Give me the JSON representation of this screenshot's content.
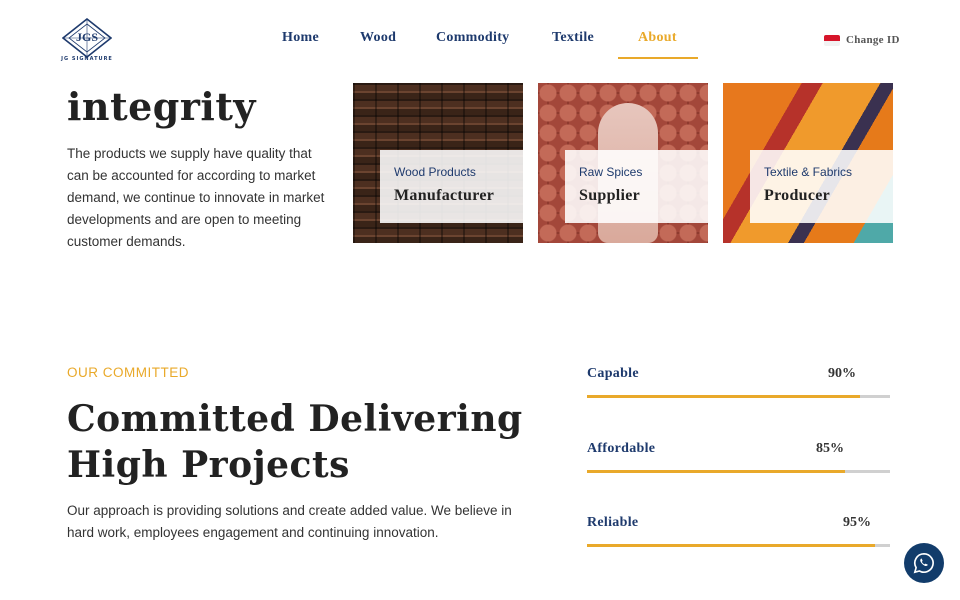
{
  "header": {
    "logo_mark": "JGS",
    "logo_text": "JG SIGNATURE",
    "nav": [
      {
        "label": "Home"
      },
      {
        "label": "Wood"
      },
      {
        "label": "Commodity"
      },
      {
        "label": "Textile"
      },
      {
        "label": "About"
      }
    ],
    "active_nav": "About",
    "language_label": "Change ID",
    "language_flag": "indonesia-flag-icon"
  },
  "hero": {
    "heading": "integrity",
    "paragraph": "The products we supply have quality that can be accounted for according to market demand, we continue to innovate in market developments and are open to meeting customer demands.",
    "cards": [
      {
        "subtitle": "Wood Products",
        "title": "Manufacturer"
      },
      {
        "subtitle": "Raw Spices",
        "title": "Supplier"
      },
      {
        "subtitle": "Textile & Fabrics",
        "title": "Producer"
      }
    ]
  },
  "commitment": {
    "eyebrow": "OUR COMMITTED",
    "title": "Committed Delivering High Projects",
    "paragraph": "Our approach is providing solutions and create added value. We believe in hard work, employees engagement and continuing innovation.",
    "skills": [
      {
        "label": "Capable",
        "percent_text": "90%",
        "value": 0.9
      },
      {
        "label": "Affordable",
        "percent_text": "85%",
        "value": 0.85
      },
      {
        "label": "Reliable",
        "percent_text": "95%",
        "value": 0.95
      }
    ]
  },
  "colors": {
    "accent": "#e9a92a",
    "navy": "#1e3a6d",
    "chat_button": "#123c6b"
  },
  "chat": {
    "icon": "whatsapp-icon"
  }
}
